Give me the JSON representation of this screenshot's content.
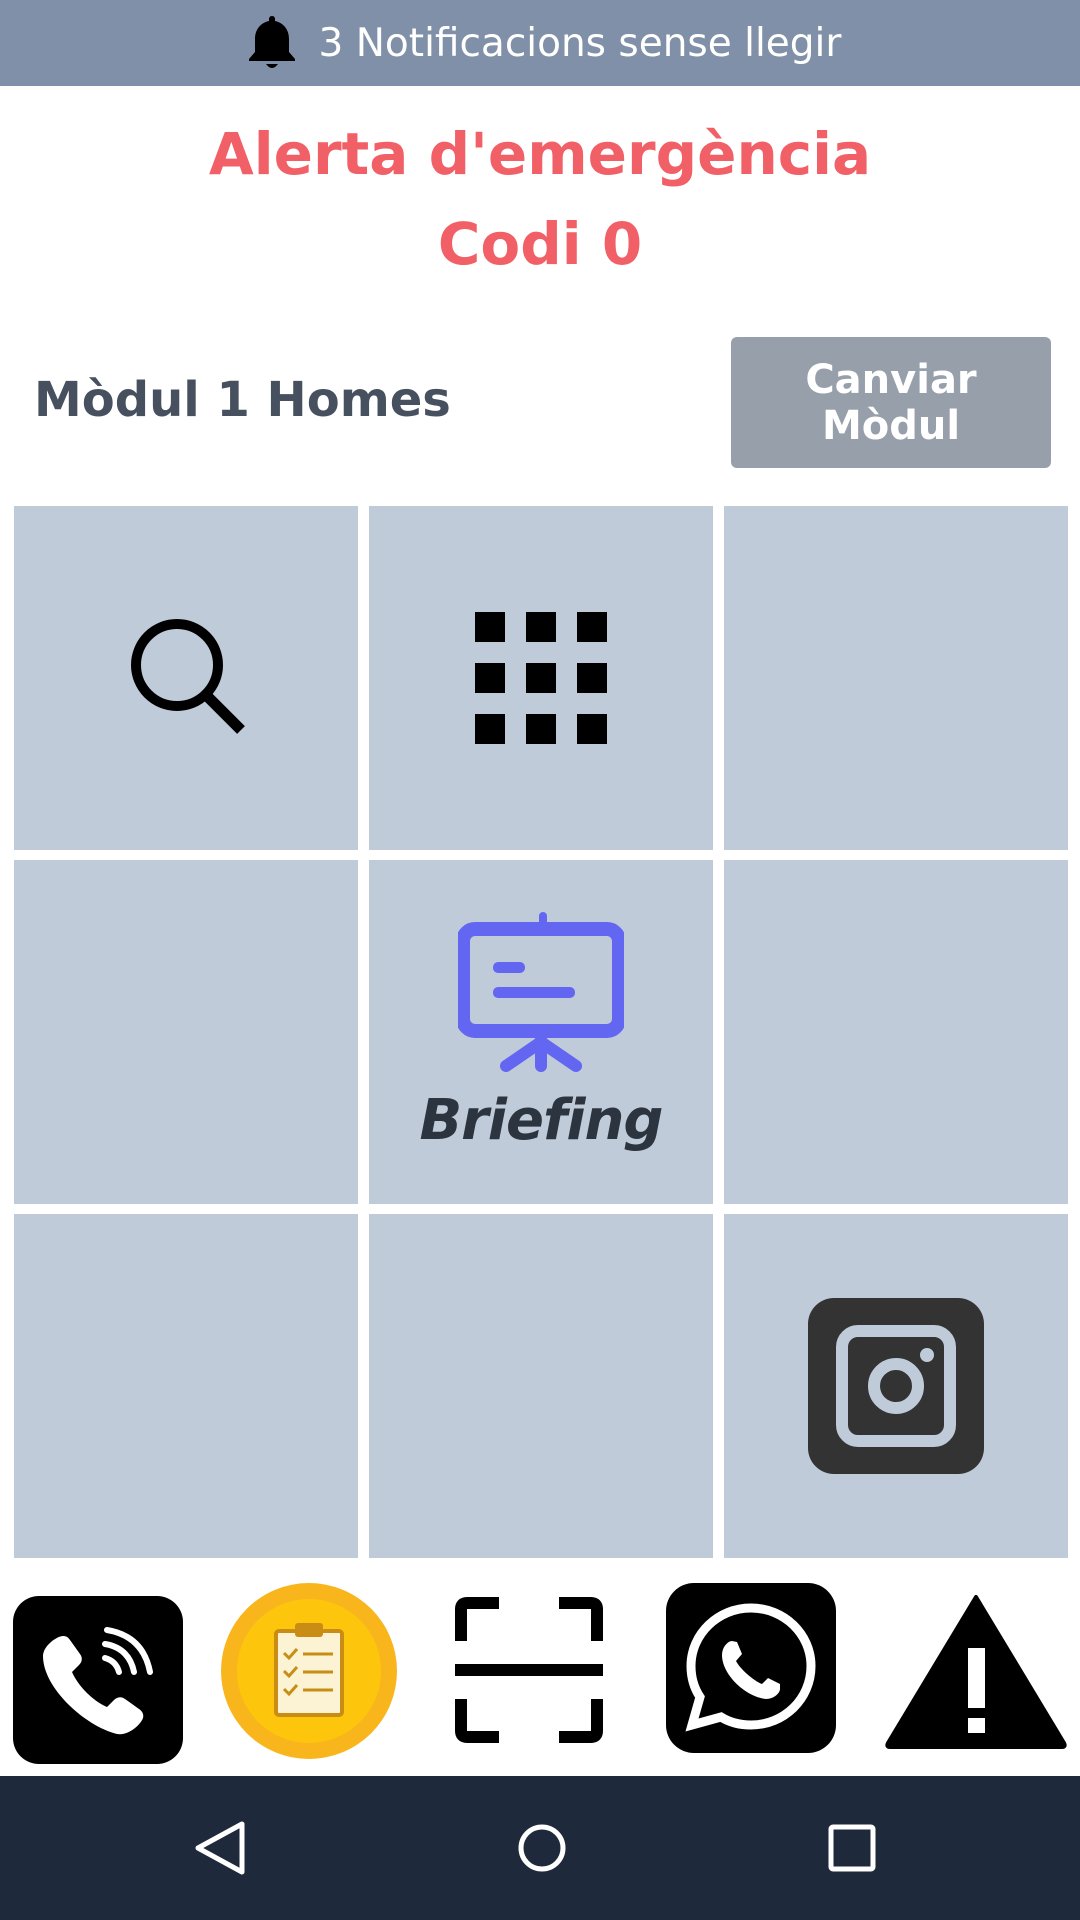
{
  "notifications": {
    "text": "3 Notificacions sense llegir",
    "icon": "bell-icon"
  },
  "alert": {
    "title": "Alerta d'emergència",
    "code": "Codi 0"
  },
  "module": {
    "name": "Mòdul 1 Homes",
    "change_label": "Canviar Mòdul"
  },
  "grid": {
    "tiles": [
      {
        "icon": "search-icon",
        "label": ""
      },
      {
        "icon": "apps-grid-icon",
        "label": ""
      },
      {
        "icon": "",
        "label": ""
      },
      {
        "icon": "",
        "label": ""
      },
      {
        "icon": "briefing-presentation-icon",
        "label": "Briefing"
      },
      {
        "icon": "",
        "label": ""
      },
      {
        "icon": "",
        "label": ""
      },
      {
        "icon": "",
        "label": ""
      },
      {
        "icon": "instagram-icon",
        "label": ""
      }
    ]
  },
  "dock": {
    "items": [
      "viber-phone-icon",
      "clipboard-checklist-icon",
      "scan-frame-icon",
      "whatsapp-icon",
      "warning-icon"
    ]
  },
  "nav": {
    "items": [
      "back-icon",
      "home-icon",
      "recents-icon"
    ]
  },
  "colors": {
    "notif_bar": "#8090a8",
    "alert_red": "#f15f67",
    "tile_bg": "#c0cbd9",
    "button_gray": "#979fab",
    "briefing_purple": "#6366f1",
    "nav_bg": "#1e2a3b"
  }
}
